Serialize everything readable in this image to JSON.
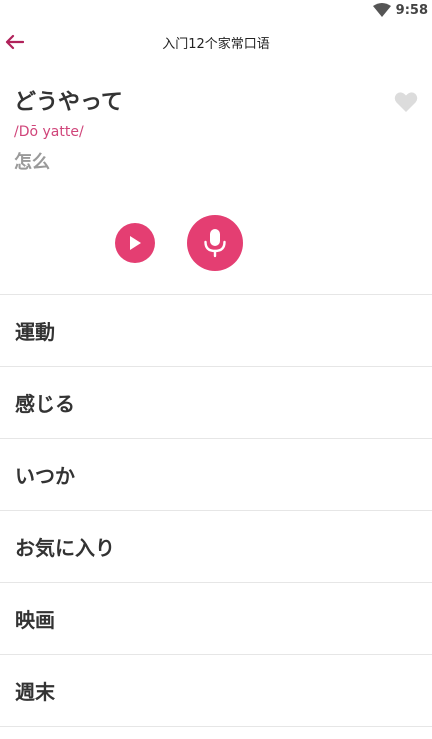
{
  "status_bar": {
    "time": "9:58",
    "wifi_icon": "wifi-icon"
  },
  "header": {
    "title": "入门12个家常口语",
    "back_icon": "arrow-left-icon"
  },
  "card": {
    "word": "どうやって",
    "romaji": "/Dō yatte/",
    "meaning": "怎么",
    "favorite_icon": "heart-icon"
  },
  "controls": {
    "play_icon": "play-icon",
    "mic_icon": "microphone-icon"
  },
  "colors": {
    "accent": "#e43e72",
    "romaji": "#d0457a",
    "back_arrow": "#b0225a"
  },
  "list": [
    {
      "label": "運動"
    },
    {
      "label": "感じる"
    },
    {
      "label": "いつか"
    },
    {
      "label": "お気に入り"
    },
    {
      "label": "映画"
    },
    {
      "label": "週末"
    }
  ]
}
